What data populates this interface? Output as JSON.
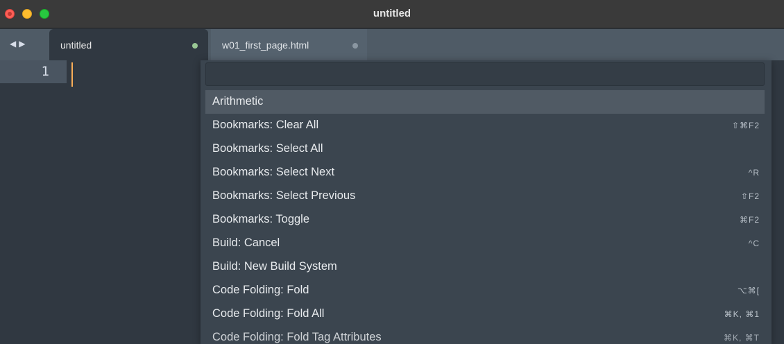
{
  "window": {
    "title": "untitled",
    "controls": {
      "close_color": "#fe5f57",
      "minimize_color": "#febc2e",
      "maximize_color": "#28c840"
    }
  },
  "tabs": [
    {
      "label": "untitled",
      "active": true,
      "dot_color": "#99c794"
    },
    {
      "label": "w01_first_page.html",
      "active": false,
      "dot_color": "#8a96a1"
    }
  ],
  "navigation": {
    "icons": [
      "left-arrow-icon",
      "right-arrow-icon"
    ],
    "glyph": "◀▶"
  },
  "editor": {
    "line_number": "1",
    "cursor_color": "#f9ae58"
  },
  "command_palette": {
    "query": "",
    "items": [
      {
        "label": "Arithmetic",
        "shortcut": "",
        "selected": true
      },
      {
        "label": "Bookmarks: Clear All",
        "shortcut": "⇧⌘F2",
        "selected": false
      },
      {
        "label": "Bookmarks: Select All",
        "shortcut": "",
        "selected": false
      },
      {
        "label": "Bookmarks: Select Next",
        "shortcut": "^R",
        "selected": false
      },
      {
        "label": "Bookmarks: Select Previous",
        "shortcut": "⇧F2",
        "selected": false
      },
      {
        "label": "Bookmarks: Toggle",
        "shortcut": "⌘F2",
        "selected": false
      },
      {
        "label": "Build: Cancel",
        "shortcut": "^C",
        "selected": false
      },
      {
        "label": "Build: New Build System",
        "shortcut": "",
        "selected": false
      },
      {
        "label": "Code Folding: Fold",
        "shortcut": "⌥⌘[",
        "selected": false
      },
      {
        "label": "Code Folding: Fold All",
        "shortcut": "⌘K, ⌘1",
        "selected": false
      },
      {
        "label": "Code Folding: Fold Tag Attributes",
        "shortcut": "⌘K, ⌘T",
        "selected": false
      }
    ]
  },
  "colors": {
    "titlebar": "#3a3a3a",
    "tabbar": "#4f5b66",
    "editor_background": "#303841",
    "palette_background": "#3b454f",
    "selected_row": "#505a64"
  }
}
